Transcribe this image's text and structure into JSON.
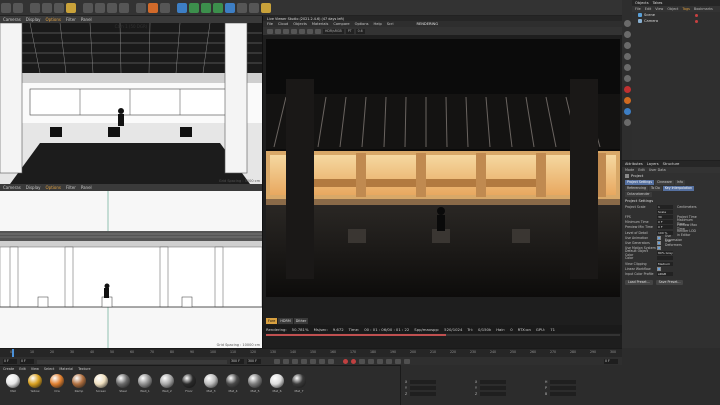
{
  "app": {
    "title": "Live Viewer Studio (2021.2.4.6) (47 days left)"
  },
  "viewport_top": {
    "menu": [
      "Cameras",
      "Display",
      "Options",
      "Filter",
      "Panel"
    ],
    "camera_label": "Cam 1 (50 DGR)",
    "grid_spacing": "Grid Spacing : 5000 cm"
  },
  "viewport_bottom": {
    "menu": [
      "Cameras",
      "Display",
      "Options",
      "Filter",
      "Panel"
    ],
    "grid_spacing": "Grid Spacing : 10000 cm"
  },
  "render_view": {
    "menu": [
      "File",
      "Cloud",
      "Objects",
      "Materials",
      "Compare",
      "Options",
      "Help",
      "Scri"
    ],
    "mode": "RENDERING",
    "fields": [
      "HDR/sRGB",
      "PT",
      "0.6"
    ],
    "tabs": [
      "Fore",
      "HDRM",
      "Dither"
    ],
    "active_tab": "Fore",
    "status": {
      "rendering_label": "Rendering:",
      "rendering_value": "50.781%",
      "mssec_label": "Ms/sec:",
      "mssec_value": "9.672",
      "time_label": "Time:",
      "time_value": "00 : 01 : 06/00 : 01 : 22",
      "spp_label": "Spp/maxspp:",
      "spp_value": "520/1024",
      "tri_label": "Tri:",
      "tri_value": "0/150k",
      "hair_label": "Hair:",
      "hair_value": "0",
      "rtx_label": "RTX:on",
      "gpu_label": "GPU:",
      "gpu_value": "71",
      "progress": 0.508
    }
  },
  "objects_panel": {
    "tabs": [
      "Objects",
      "Takes"
    ],
    "menu": [
      "File",
      "Edit",
      "View",
      "Object",
      "Tags",
      "Bookmarks"
    ],
    "items": [
      {
        "name": "Scene",
        "type": "null"
      },
      {
        "name": "Camera",
        "type": "camera"
      }
    ]
  },
  "attributes_panel": {
    "tabs": [
      "Attributes",
      "Layers",
      "Structure"
    ],
    "menu": [
      "Mode",
      "Edit",
      "User Data"
    ],
    "title": "Project",
    "sub_tabs": [
      "Project Settings",
      "Cineware",
      "Info",
      "Referencing",
      "To Do",
      "Key Interpolation",
      "Octanebender"
    ],
    "section": "Project Settings",
    "rows": [
      {
        "label": "Project Scale",
        "value": "1",
        "right_label": "Centimeters"
      },
      {
        "label": "",
        "value": "Scale Project...",
        "right_label": ""
      },
      {
        "label": "FPS",
        "value": "30",
        "right_label": "Project Time"
      },
      {
        "label": "Minimum Time",
        "value": "0 F",
        "right_label": "Maximum Time"
      },
      {
        "label": "Preview Min Time",
        "value": "0 F",
        "right_label": "Preview Max Time"
      },
      {
        "label": "Level of Detail",
        "value": "100 %",
        "right_label": "Render LOD in Editor"
      },
      {
        "label": "Use Animation",
        "check": true,
        "right_label": "Use Expression"
      },
      {
        "label": "Use Generators",
        "check": true,
        "right_label": "Use Deformers"
      },
      {
        "label": "Use Motion System",
        "check": true,
        "right_label": ""
      },
      {
        "label": "Default Object Color",
        "value": "80% Gray",
        "right_label": ""
      },
      {
        "label": "Color",
        "value": "",
        "right_label": ""
      },
      {
        "label": "View Clipping",
        "value": "Medium",
        "right_label": ""
      },
      {
        "label": "Linear Workflow",
        "check": true,
        "right_label": ""
      },
      {
        "label": "Input Color Profile",
        "value": "sRGB",
        "right_label": ""
      }
    ],
    "buttons": [
      "Load Preset...",
      "Save Preset..."
    ]
  },
  "timeline": {
    "ticks": [
      "0",
      "10",
      "20",
      "30",
      "40",
      "50",
      "60",
      "70",
      "80",
      "90",
      "100",
      "110",
      "120",
      "130",
      "140",
      "150",
      "160",
      "170",
      "180",
      "190",
      "200",
      "210",
      "220",
      "230",
      "240",
      "250",
      "260",
      "270",
      "280",
      "290",
      "300"
    ],
    "current_frame": "0 F",
    "start": "0 F",
    "end": "300 F",
    "end_field": "300 F",
    "fps_field": "0 F"
  },
  "materials": {
    "menu": [
      "Create",
      "Edit",
      "View",
      "Select",
      "Material",
      "Texture"
    ],
    "items": [
      {
        "name": "Mat",
        "color": "#e8e8e8"
      },
      {
        "name": "Yellow",
        "color": "#d8a020"
      },
      {
        "name": "Ora",
        "color": "#e08030"
      },
      {
        "name": "Ramp",
        "color": "#b07040"
      },
      {
        "name": "Screen",
        "color": "#f0e0c0"
      },
      {
        "name": "Steel",
        "color": "#6a6a6a"
      },
      {
        "name": "Wall_1",
        "color": "#909090"
      },
      {
        "name": "Wall_2",
        "color": "#a8a8a8"
      },
      {
        "name": "Floor",
        "color": "#2a2a2a"
      },
      {
        "name": "Mat_3",
        "color": "#bcbcbc"
      },
      {
        "name": "Mat_4",
        "color": "#4a4a4a"
      },
      {
        "name": "Mat_5",
        "color": "#7c7c7c"
      },
      {
        "name": "Mat_6",
        "color": "#dcdcdc"
      },
      {
        "name": "Mat_7",
        "color": "#3a3a3a"
      }
    ]
  },
  "coordinates": {
    "cols": [
      {
        "rows": [
          "X",
          "Y",
          "Z"
        ]
      },
      {
        "rows": [
          "X",
          "Y",
          "Z"
        ]
      },
      {
        "rows": [
          "H",
          "P",
          "B"
        ]
      }
    ],
    "apply": "Apply"
  },
  "colors": {
    "accent": "#3d7ec4",
    "active_tab": "#d8a040",
    "progress": "#c05050"
  }
}
